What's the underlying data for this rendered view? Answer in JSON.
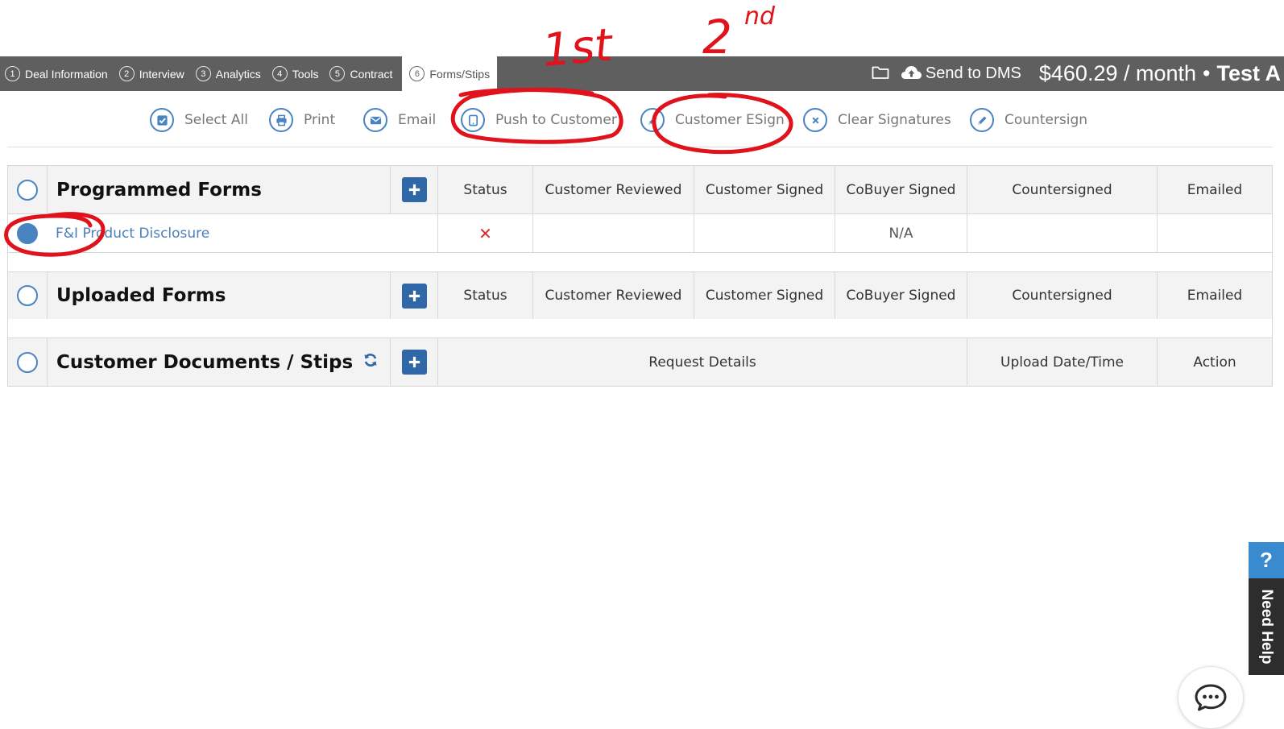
{
  "nav": {
    "steps": [
      {
        "num": "1",
        "label": "Deal Information"
      },
      {
        "num": "2",
        "label": "Interview"
      },
      {
        "num": "3",
        "label": "Analytics"
      },
      {
        "num": "4",
        "label": "Tools"
      },
      {
        "num": "5",
        "label": "Contract"
      },
      {
        "num": "6",
        "label": "Forms/Stips"
      }
    ],
    "send_to_dms": "Send to DMS",
    "payment": "$460.29 / month",
    "separator": "•",
    "deal_name": "Test A"
  },
  "toolbar": {
    "select_all": "Select All",
    "print": "Print",
    "email": "Email",
    "push_to_customer": "Push to Customer",
    "customer_esign": "Customer ESign",
    "clear_signatures": "Clear Signatures",
    "countersign": "Countersign"
  },
  "programmed_forms": {
    "title": "Programmed Forms",
    "columns": [
      "Status",
      "Customer Reviewed",
      "Customer Signed",
      "CoBuyer Signed",
      "Countersigned",
      "Emailed"
    ],
    "rows": [
      {
        "name": "F&I Product Disclosure",
        "status": "✕",
        "customer_reviewed": "",
        "customer_signed": "",
        "cobuyer_signed": "N/A",
        "countersigned": "",
        "emailed": ""
      }
    ]
  },
  "uploaded_forms": {
    "title": "Uploaded Forms",
    "columns": [
      "Status",
      "Customer Reviewed",
      "Customer Signed",
      "CoBuyer Signed",
      "Countersigned",
      "Emailed"
    ]
  },
  "customer_documents": {
    "title": "Customer Documents / Stips",
    "columns": [
      "Request Details",
      "Upload Date/Time",
      "Action"
    ]
  },
  "help": {
    "question_mark": "?",
    "label": "Need Help"
  },
  "annotations": {
    "first": "1st",
    "second": "2",
    "second_superscript": "nd"
  },
  "colors": {
    "nav_bg": "#5f5f5f",
    "accent_blue": "#4a84c0",
    "plus_button": "#2f67a7",
    "status_x": "#d92b2b",
    "annotation_red": "#e0121b"
  }
}
